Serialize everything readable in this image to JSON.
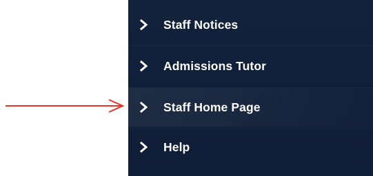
{
  "menu": {
    "items": [
      {
        "label": "Staff Notices"
      },
      {
        "label": "Admissions Tutor"
      },
      {
        "label": "Staff Home Page"
      },
      {
        "label": "Help"
      }
    ]
  },
  "colors": {
    "menu_background": "#12223c",
    "menu_text": "#ffffff",
    "annotation_arrow": "#e0362c"
  },
  "icons": {
    "menu_item": "chevron-right-icon",
    "annotation": "arrow-right-icon"
  }
}
